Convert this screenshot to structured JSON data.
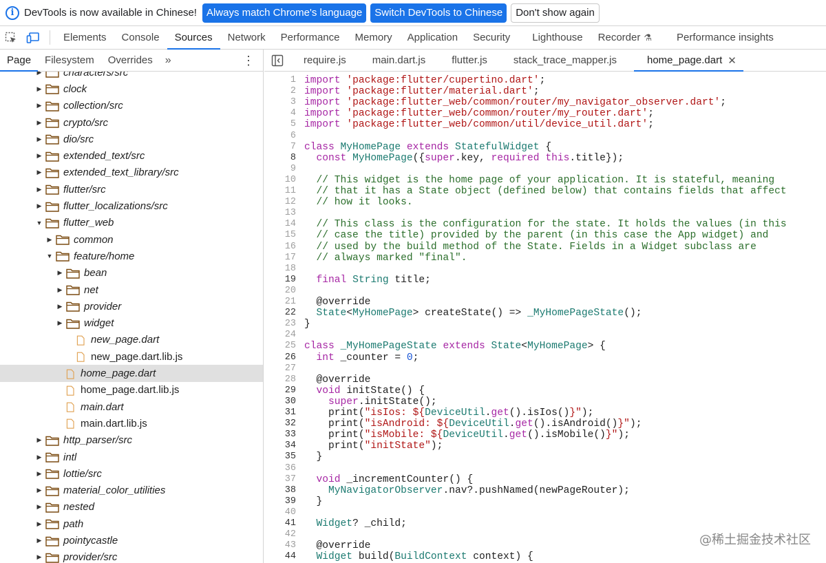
{
  "infobar": {
    "message": "DevTools is now available in Chinese!",
    "btn_match": "Always match Chrome's language",
    "btn_switch": "Switch DevTools to Chinese",
    "btn_dismiss": "Don't show again"
  },
  "toolbar": {
    "tabs": [
      "Elements",
      "Console",
      "Sources",
      "Network",
      "Performance",
      "Memory",
      "Application",
      "Security",
      "Lighthouse",
      "Recorder",
      "Performance insights"
    ],
    "active_tab": "Sources"
  },
  "navigator": {
    "subtabs": [
      "Page",
      "Filesystem",
      "Overrides"
    ],
    "more": "»",
    "tree": [
      {
        "label": "characters/src",
        "type": "folder",
        "depth": 0,
        "arrow": "▶",
        "italic": true
      },
      {
        "label": "clock",
        "type": "folder",
        "depth": 0,
        "arrow": "▶",
        "italic": true
      },
      {
        "label": "collection/src",
        "type": "folder",
        "depth": 0,
        "arrow": "▶",
        "italic": true
      },
      {
        "label": "crypto/src",
        "type": "folder",
        "depth": 0,
        "arrow": "▶",
        "italic": true
      },
      {
        "label": "dio/src",
        "type": "folder",
        "depth": 0,
        "arrow": "▶",
        "italic": true
      },
      {
        "label": "extended_text/src",
        "type": "folder",
        "depth": 0,
        "arrow": "▶",
        "italic": true
      },
      {
        "label": "extended_text_library/src",
        "type": "folder",
        "depth": 0,
        "arrow": "▶",
        "italic": true
      },
      {
        "label": "flutter/src",
        "type": "folder",
        "depth": 0,
        "arrow": "▶",
        "italic": true
      },
      {
        "label": "flutter_localizations/src",
        "type": "folder",
        "depth": 0,
        "arrow": "▶",
        "italic": true
      },
      {
        "label": "flutter_web",
        "type": "folder",
        "depth": 0,
        "arrow": "▼",
        "italic": true
      },
      {
        "label": "common",
        "type": "folder",
        "depth": 1,
        "arrow": "▶",
        "italic": true
      },
      {
        "label": "feature/home",
        "type": "folder",
        "depth": 1,
        "arrow": "▼",
        "italic": true
      },
      {
        "label": "bean",
        "type": "folder",
        "depth": 2,
        "arrow": "▶",
        "italic": true
      },
      {
        "label": "net",
        "type": "folder",
        "depth": 2,
        "arrow": "▶",
        "italic": true
      },
      {
        "label": "provider",
        "type": "folder",
        "depth": 2,
        "arrow": "▶",
        "italic": true
      },
      {
        "label": "widget",
        "type": "folder",
        "depth": 2,
        "arrow": "▶",
        "italic": true
      },
      {
        "label": "new_page.dart",
        "type": "file",
        "depth": 2,
        "arrow": "",
        "italic": true
      },
      {
        "label": "new_page.dart.lib.js",
        "type": "file",
        "depth": 2,
        "arrow": "",
        "italic": false
      },
      {
        "label": "home_page.dart",
        "type": "file",
        "depth": 1,
        "arrow": "",
        "italic": true,
        "selected": true
      },
      {
        "label": "home_page.dart.lib.js",
        "type": "file",
        "depth": 1,
        "arrow": "",
        "italic": false
      },
      {
        "label": "main.dart",
        "type": "file",
        "depth": 1,
        "arrow": "",
        "italic": true
      },
      {
        "label": "main.dart.lib.js",
        "type": "file",
        "depth": 1,
        "arrow": "",
        "italic": false
      },
      {
        "label": "http_parser/src",
        "type": "folder",
        "depth": 0,
        "arrow": "▶",
        "italic": true
      },
      {
        "label": "intl",
        "type": "folder",
        "depth": 0,
        "arrow": "▶",
        "italic": true
      },
      {
        "label": "lottie/src",
        "type": "folder",
        "depth": 0,
        "arrow": "▶",
        "italic": true
      },
      {
        "label": "material_color_utilities",
        "type": "folder",
        "depth": 0,
        "arrow": "▶",
        "italic": true
      },
      {
        "label": "nested",
        "type": "folder",
        "depth": 0,
        "arrow": "▶",
        "italic": true
      },
      {
        "label": "path",
        "type": "folder",
        "depth": 0,
        "arrow": "▶",
        "italic": true
      },
      {
        "label": "pointycastle",
        "type": "folder",
        "depth": 0,
        "arrow": "▶",
        "italic": true
      },
      {
        "label": "provider/src",
        "type": "folder",
        "depth": 0,
        "arrow": "▶",
        "italic": true
      }
    ]
  },
  "editor": {
    "tabs": [
      "require.js",
      "main.dart.js",
      "flutter.js",
      "stack_trace_mapper.js",
      "home_page.dart"
    ],
    "active_tab": "home_page.dart",
    "close": "✕",
    "lines": [
      [
        [
          "kw",
          "import "
        ],
        [
          "st",
          "'package:flutter/cupertino.dart'"
        ],
        [
          "pl",
          ";"
        ]
      ],
      [
        [
          "kw",
          "import "
        ],
        [
          "st",
          "'package:flutter/material.dart'"
        ],
        [
          "pl",
          ";"
        ]
      ],
      [
        [
          "kw",
          "import "
        ],
        [
          "st",
          "'package:flutter_web/common/router/my_navigator_observer.dart'"
        ],
        [
          "pl",
          ";"
        ]
      ],
      [
        [
          "kw",
          "import "
        ],
        [
          "st",
          "'package:flutter_web/common/router/my_router.dart'"
        ],
        [
          "pl",
          ";"
        ]
      ],
      [
        [
          "kw",
          "import "
        ],
        [
          "st",
          "'package:flutter_web/common/util/device_util.dart'"
        ],
        [
          "pl",
          ";"
        ]
      ],
      [],
      [
        [
          "kw",
          "class "
        ],
        [
          "ty",
          "MyHomePage "
        ],
        [
          "kw",
          "extends "
        ],
        [
          "ty",
          "StatefulWidget"
        ],
        [
          "pl",
          " {"
        ]
      ],
      [
        [
          "pl",
          "  "
        ],
        [
          "kw",
          "const "
        ],
        [
          "ty",
          "MyHomePage"
        ],
        [
          "pl",
          "({"
        ],
        [
          "kw",
          "super"
        ],
        [
          "pl",
          ".key, "
        ],
        [
          "kw",
          "required this"
        ],
        [
          "pl",
          ".title});"
        ]
      ],
      [],
      [
        [
          "cm",
          "  // This widget is the home page of your application. It is stateful, meaning"
        ]
      ],
      [
        [
          "cm",
          "  // that it has a State object (defined below) that contains fields that affect"
        ]
      ],
      [
        [
          "cm",
          "  // how it looks."
        ]
      ],
      [],
      [
        [
          "cm",
          "  // This class is the configuration for the state. It holds the values (in this"
        ]
      ],
      [
        [
          "cm",
          "  // case the title) provided by the parent (in this case the App widget) and"
        ]
      ],
      [
        [
          "cm",
          "  // used by the build method of the State. Fields in a Widget subclass are"
        ]
      ],
      [
        [
          "cm",
          "  // always marked \"final\"."
        ]
      ],
      [],
      [
        [
          "pl",
          "  "
        ],
        [
          "kw",
          "final "
        ],
        [
          "ty",
          "String "
        ],
        [
          "pl",
          "title;"
        ]
      ],
      [],
      [
        [
          "pl",
          "  @override"
        ]
      ],
      [
        [
          "pl",
          "  "
        ],
        [
          "ty",
          "State"
        ],
        [
          "pl",
          "<"
        ],
        [
          "ty",
          "MyHomePage"
        ],
        [
          "pl",
          "> createState() => "
        ],
        [
          "ty",
          "_MyHomePageState"
        ],
        [
          "pl",
          "();"
        ]
      ],
      [
        [
          "pl",
          "}"
        ]
      ],
      [],
      [
        [
          "kw",
          "class "
        ],
        [
          "ty",
          "_MyHomePageState "
        ],
        [
          "kw",
          "extends "
        ],
        [
          "ty",
          "State"
        ],
        [
          "pl",
          "<"
        ],
        [
          "ty",
          "MyHomePage"
        ],
        [
          "pl",
          "> {"
        ]
      ],
      [
        [
          "pl",
          "  "
        ],
        [
          "kw",
          "int "
        ],
        [
          "pl",
          "_counter = "
        ],
        [
          "nm",
          "0"
        ],
        [
          "pl",
          ";"
        ]
      ],
      [],
      [
        [
          "pl",
          "  @override"
        ]
      ],
      [
        [
          "pl",
          "  "
        ],
        [
          "kw",
          "void "
        ],
        [
          "pl",
          "initState() {"
        ]
      ],
      [
        [
          "pl",
          "    "
        ],
        [
          "kw",
          "super"
        ],
        [
          "pl",
          ".initState();"
        ]
      ],
      [
        [
          "pl",
          "    print("
        ],
        [
          "st",
          "\"isIos: ${"
        ],
        [
          "ty",
          "DeviceUtil"
        ],
        [
          "pl",
          "."
        ],
        [
          "kw",
          "get"
        ],
        [
          "pl",
          "().isIos()"
        ],
        [
          "st",
          "}\""
        ],
        [
          "pl",
          ");"
        ]
      ],
      [
        [
          "pl",
          "    print("
        ],
        [
          "st",
          "\"isAndroid: ${"
        ],
        [
          "ty",
          "DeviceUtil"
        ],
        [
          "pl",
          "."
        ],
        [
          "kw",
          "get"
        ],
        [
          "pl",
          "().isAndroid()"
        ],
        [
          "st",
          "}\""
        ],
        [
          "pl",
          ");"
        ]
      ],
      [
        [
          "pl",
          "    print("
        ],
        [
          "st",
          "\"isMobile: ${"
        ],
        [
          "ty",
          "DeviceUtil"
        ],
        [
          "pl",
          "."
        ],
        [
          "kw",
          "get"
        ],
        [
          "pl",
          "().isMobile()"
        ],
        [
          "st",
          "}\""
        ],
        [
          "pl",
          ");"
        ]
      ],
      [
        [
          "pl",
          "    print("
        ],
        [
          "st",
          "\"initState\""
        ],
        [
          "pl",
          ");"
        ]
      ],
      [
        [
          "pl",
          "  }"
        ]
      ],
      [],
      [
        [
          "pl",
          "  "
        ],
        [
          "kw",
          "void "
        ],
        [
          "pl",
          "_incrementCounter() {"
        ]
      ],
      [
        [
          "pl",
          "    "
        ],
        [
          "ty",
          "MyNavigatorObserver"
        ],
        [
          "pl",
          ".nav?.pushNamed(newPageRouter);"
        ]
      ],
      [
        [
          "pl",
          "  }"
        ]
      ],
      [],
      [
        [
          "pl",
          "  "
        ],
        [
          "ty",
          "Widget"
        ],
        [
          "pl",
          "? _child;"
        ]
      ],
      [],
      [
        [
          "pl",
          "  @override"
        ]
      ],
      [
        [
          "pl",
          "  "
        ],
        [
          "ty",
          "Widget "
        ],
        [
          "pl",
          "build("
        ],
        [
          "ty",
          "BuildContext "
        ],
        [
          "pl",
          "context) {"
        ]
      ]
    ],
    "bold_lines": [
      8,
      19,
      22,
      26,
      29,
      30,
      31,
      32,
      33,
      34,
      35,
      38,
      39,
      41,
      44
    ]
  },
  "watermark": "@稀土掘金技术社区"
}
